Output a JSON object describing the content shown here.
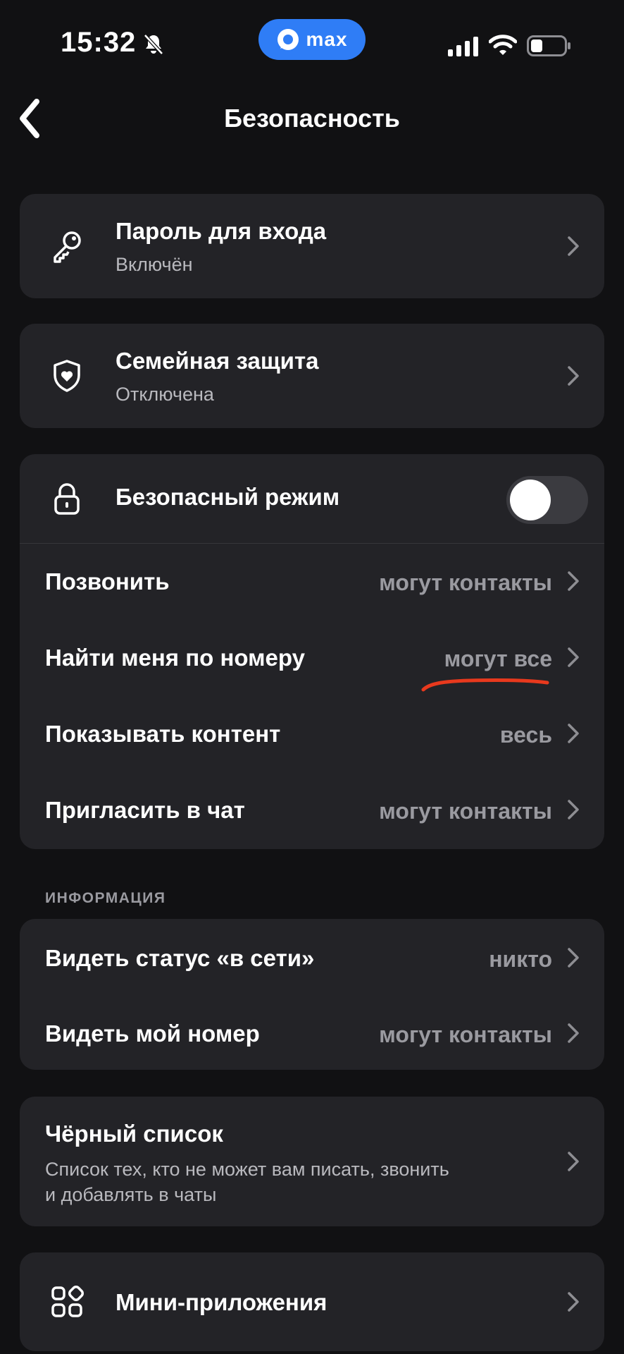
{
  "status_bar": {
    "time": "15:32",
    "app_pill": "max"
  },
  "header": {
    "title": "Безопасность"
  },
  "password_card": {
    "title": "Пароль для входа",
    "status": "Включён"
  },
  "family_card": {
    "title": "Семейная защита",
    "status": "Отключена"
  },
  "safe_mode": {
    "title": "Безопасный режим",
    "toggle_on": false,
    "rows": [
      {
        "label": "Позвонить",
        "value": "могут контакты"
      },
      {
        "label": "Найти меня по номеру",
        "value": "могут все"
      },
      {
        "label": "Показывать контент",
        "value": "весь"
      },
      {
        "label": "Пригласить в чат",
        "value": "могут контакты"
      }
    ]
  },
  "info_section": {
    "header": "ИНФОРМАЦИЯ",
    "rows": [
      {
        "label": "Видеть статус «в сети»",
        "value": "никто"
      },
      {
        "label": "Видеть мой номер",
        "value": "могут контакты"
      }
    ]
  },
  "blacklist": {
    "title": "Чёрный список",
    "description_line1": "Список тех, кто не может вам писать, звонить",
    "description_line2": "и добавлять в чаты"
  },
  "mini_apps": {
    "title": "Мини-приложения"
  },
  "colors": {
    "background": "#111113",
    "card": "#232327",
    "accent": "#2f7df6",
    "annotation": "#e8391d"
  }
}
